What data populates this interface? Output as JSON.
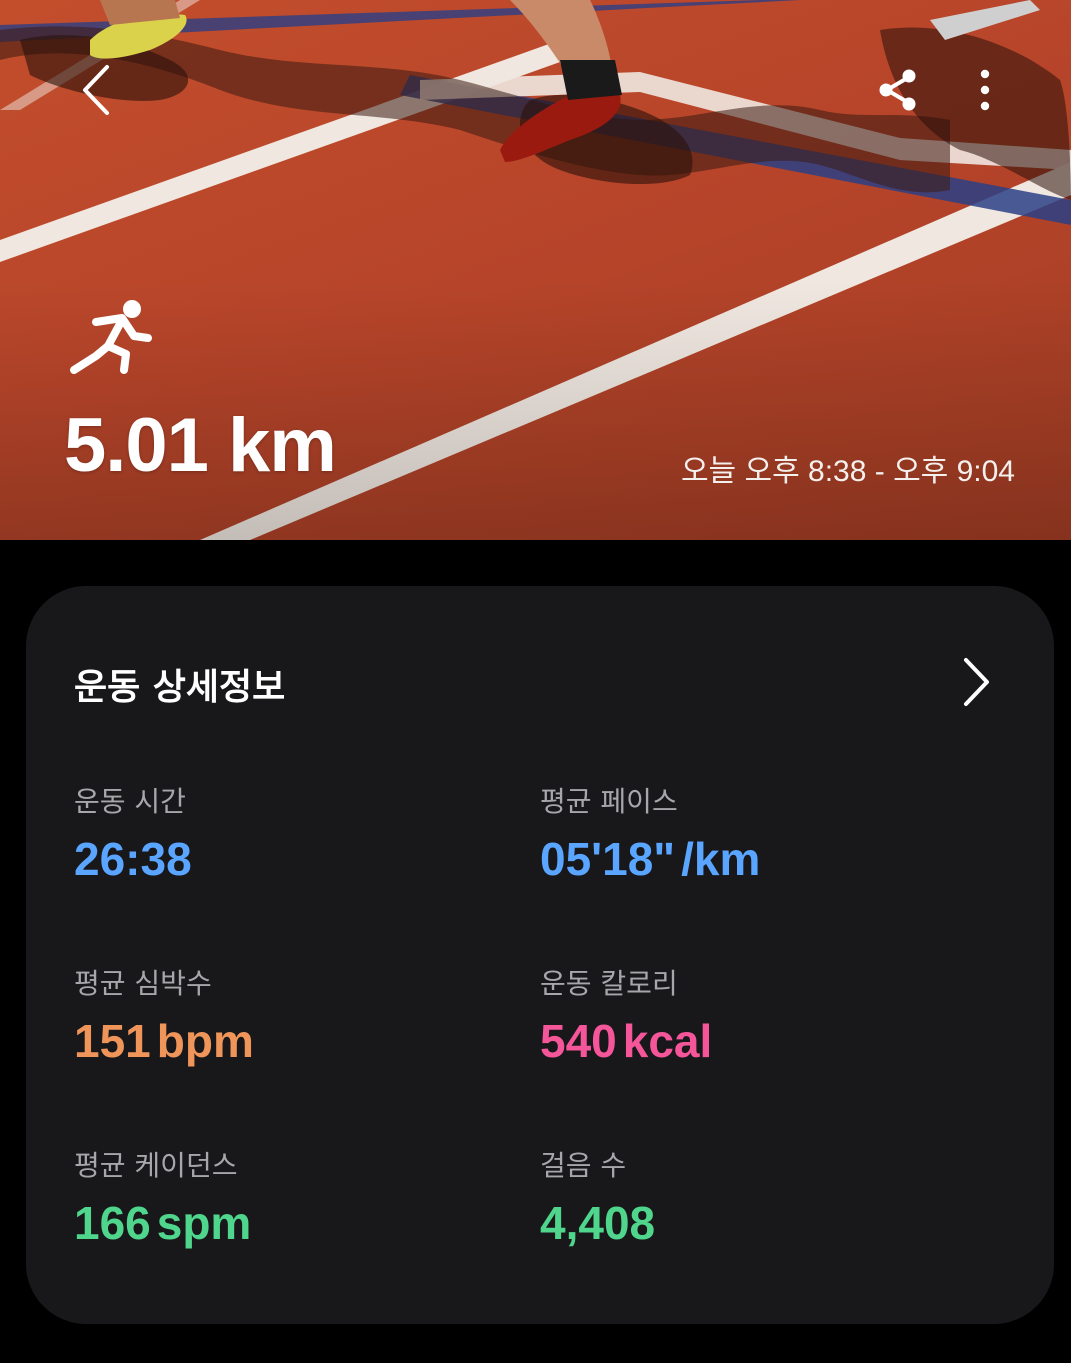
{
  "header": {
    "distance": "5.01 km",
    "time_range": "오늘 오후 8:38 - 오후 9:04",
    "activity_icon": "running-icon",
    "back_icon": "chevron-left-icon",
    "share_icon": "share-icon",
    "more_icon": "more-vertical-icon"
  },
  "details": {
    "title": "운동 상세정보",
    "chevron_icon": "chevron-right-icon",
    "stats": [
      {
        "label": "운동 시간",
        "value": "26:38",
        "unit": "",
        "color": "#5aa5ff"
      },
      {
        "label": "평균 페이스",
        "value": "05'18\"",
        "unit": "/km",
        "color": "#5aa5ff"
      },
      {
        "label": "평균 심박수",
        "value": "151",
        "unit": "bpm",
        "color": "#f0955a"
      },
      {
        "label": "운동 칼로리",
        "value": "540",
        "unit": "kcal",
        "color": "#f5569a"
      },
      {
        "label": "평균 케이던스",
        "value": "166",
        "unit": "spm",
        "color": "#4fd68c"
      },
      {
        "label": "걸음 수",
        "value": "4,408",
        "unit": "",
        "color": "#4fd68c"
      }
    ]
  }
}
